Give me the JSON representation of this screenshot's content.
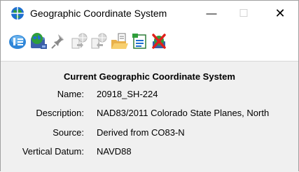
{
  "window": {
    "title": "Geographic Coordinate System",
    "minimize_glyph": "—",
    "maximize_glyph": "☐",
    "close_glyph": "✕"
  },
  "toolbar": {
    "buttons": [
      {
        "icon": "info-icon"
      },
      {
        "icon": "database-globe-icon"
      },
      {
        "icon": "pushpin-icon"
      },
      {
        "icon": "import-icon",
        "disabled": true
      },
      {
        "icon": "export-icon",
        "disabled": true
      },
      {
        "icon": "open-folder-icon"
      },
      {
        "icon": "document-list-icon"
      },
      {
        "icon": "delete-icon"
      }
    ]
  },
  "details": {
    "heading": "Current Geographic Coordinate System",
    "fields": [
      {
        "label": "Name:",
        "value": "20918_SH-224"
      },
      {
        "label": "Description:",
        "value": "NAD83/2011 Colorado State Planes, North"
      },
      {
        "label": "Source:",
        "value": "Derived from CO83-N"
      },
      {
        "label": "Vertical Datum:",
        "value": "NAVD88"
      }
    ]
  },
  "colors": {
    "content_bg": "#f0f0f0",
    "globe_blue": "#1e6fd0",
    "globe_green": "#2e9e3a",
    "delete_red": "#e0201b"
  }
}
